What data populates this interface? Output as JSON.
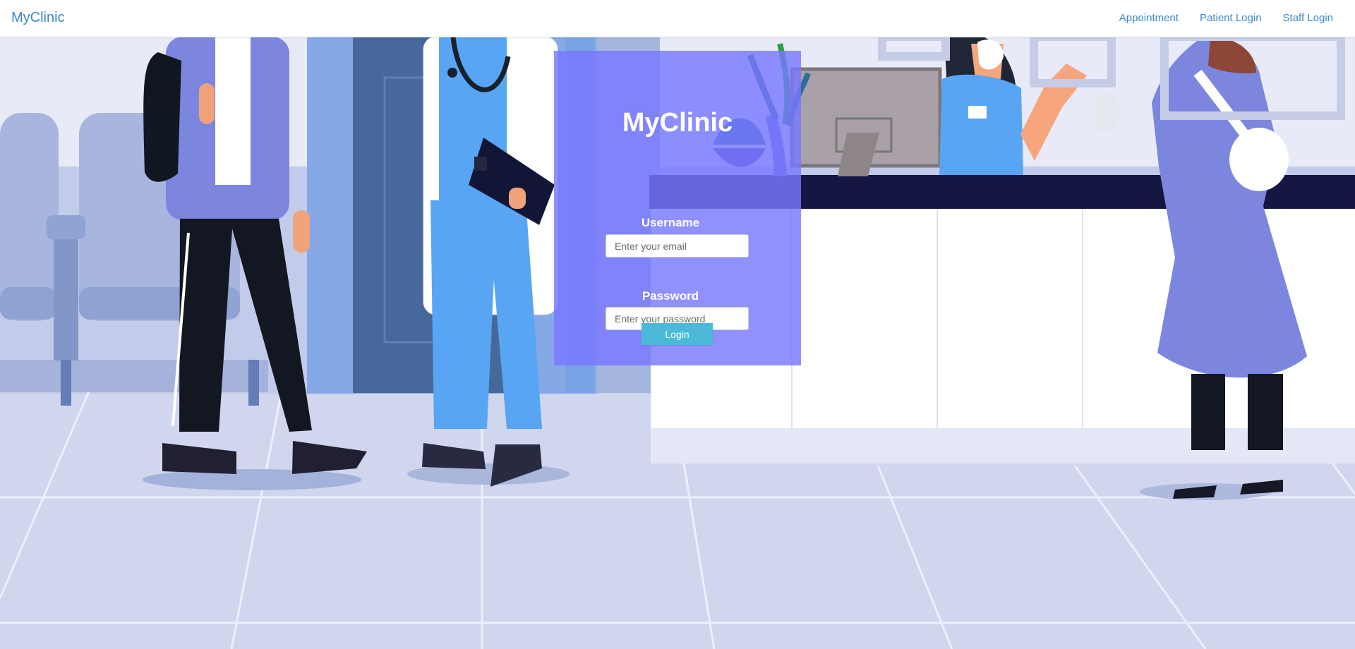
{
  "header": {
    "brand": "MyClinic",
    "links": [
      {
        "label": "Appointment"
      },
      {
        "label": "Patient Login"
      },
      {
        "label": "Staff Login"
      }
    ]
  },
  "login": {
    "title": "MyClinic",
    "username_label": "Username",
    "username_placeholder": "Enter your email",
    "password_label": "Password",
    "password_placeholder": "Enter your password",
    "button": "Login"
  },
  "colors": {
    "brand_link": "#3f87c8",
    "panel_overlay": "#7878ff",
    "login_button": "#4bb9d8",
    "floor": "#d1d6ef"
  }
}
